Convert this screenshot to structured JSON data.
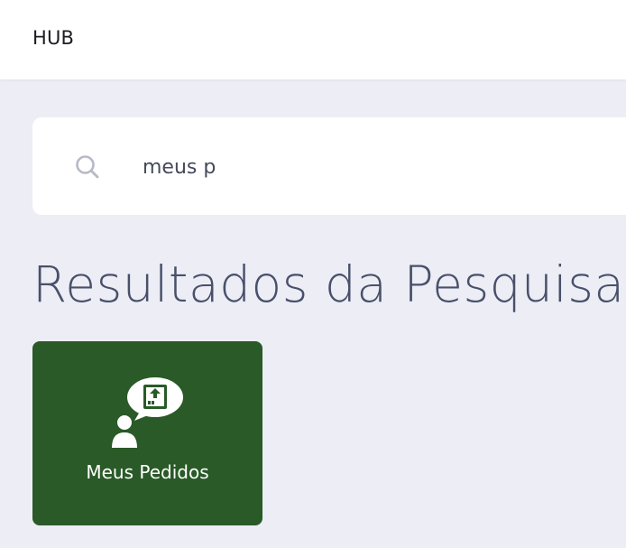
{
  "header": {
    "brand": "HUB"
  },
  "search": {
    "icon": "search-icon",
    "value": "meus p"
  },
  "results": {
    "title": "Resultados da Pesquisa",
    "items": [
      {
        "label": "Meus Pedidos",
        "icon": "user-order-bubble-icon",
        "color": "#295a27"
      }
    ]
  }
}
